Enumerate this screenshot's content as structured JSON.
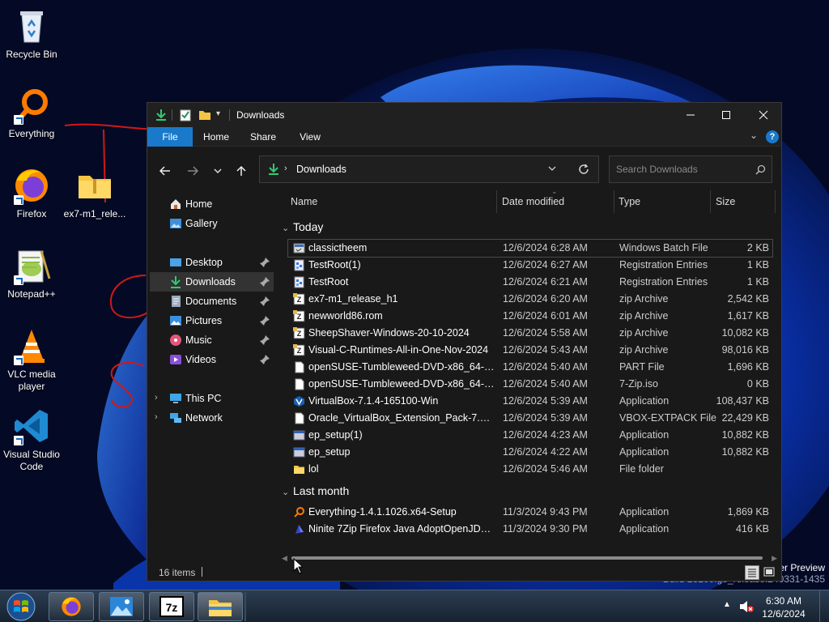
{
  "desktop": {
    "icons": [
      {
        "label": "Recycle Bin",
        "icon": "recycle-bin-icon"
      },
      {
        "label": "Everything",
        "icon": "everything-icon"
      },
      {
        "label": "Firefox",
        "icon": "firefox-icon"
      },
      {
        "label": "ex7-m1_rele...",
        "icon": "folder-zip-icon"
      },
      {
        "label": "Notepad++",
        "icon": "notepadpp-icon"
      },
      {
        "label": "VLC media player",
        "icon": "vlc-icon"
      },
      {
        "label": "Visual Studio Code",
        "icon": "vscode-icon"
      }
    ],
    "watermark_line1": "er Preview",
    "watermark_line2": "Build 26100.ge_release.240331-1435"
  },
  "window": {
    "title": "Downloads",
    "ribbon_tabs": [
      "File",
      "Home",
      "Share",
      "View"
    ],
    "address": {
      "location": "Downloads"
    },
    "search": {
      "placeholder": "Search Downloads"
    },
    "sidebar": {
      "items": [
        {
          "label": "Home",
          "icon": "home-icon",
          "pinned": false
        },
        {
          "label": "Gallery",
          "icon": "gallery-icon",
          "pinned": false
        },
        {
          "label": "Desktop",
          "icon": "desktop-icon",
          "pinned": true
        },
        {
          "label": "Downloads",
          "icon": "downloads-icon",
          "pinned": true,
          "selected": true
        },
        {
          "label": "Documents",
          "icon": "documents-icon",
          "pinned": true
        },
        {
          "label": "Pictures",
          "icon": "pictures-icon",
          "pinned": true
        },
        {
          "label": "Music",
          "icon": "music-icon",
          "pinned": true
        },
        {
          "label": "Videos",
          "icon": "videos-icon",
          "pinned": true
        },
        {
          "label": "This PC",
          "icon": "this-pc-icon",
          "expandable": true
        },
        {
          "label": "Network",
          "icon": "network-icon",
          "expandable": true
        }
      ]
    },
    "columns": [
      "Name",
      "Date modified",
      "Type",
      "Size"
    ],
    "groups": [
      {
        "label": "Today",
        "files": [
          {
            "name": "classictheem",
            "date": "12/6/2024 6:28 AM",
            "type": "Windows Batch File",
            "size": "2 KB",
            "icon": "batch-file-icon"
          },
          {
            "name": "TestRoot(1)",
            "date": "12/6/2024 6:27 AM",
            "type": "Registration Entries",
            "size": "1 KB",
            "icon": "registry-file-icon"
          },
          {
            "name": "TestRoot",
            "date": "12/6/2024 6:21 AM",
            "type": "Registration Entries",
            "size": "1 KB",
            "icon": "registry-file-icon"
          },
          {
            "name": "ex7-m1_release_h1",
            "date": "12/6/2024 6:20 AM",
            "type": "zip Archive",
            "size": "2,542 KB",
            "icon": "7zip-archive-icon"
          },
          {
            "name": "newworld86.rom",
            "date": "12/6/2024 6:01 AM",
            "type": "zip Archive",
            "size": "1,617 KB",
            "icon": "7zip-archive-icon"
          },
          {
            "name": "SheepShaver-Windows-20-10-2024",
            "date": "12/6/2024 5:58 AM",
            "type": "zip Archive",
            "size": "10,082 KB",
            "icon": "7zip-archive-icon"
          },
          {
            "name": "Visual-C-Runtimes-All-in-One-Nov-2024",
            "date": "12/6/2024 5:43 AM",
            "type": "zip Archive",
            "size": "98,016 KB",
            "icon": "7zip-archive-icon"
          },
          {
            "name": "openSUSE-Tumbleweed-DVD-x86_64-Sn...",
            "date": "12/6/2024 5:40 AM",
            "type": "PART File",
            "size": "1,696 KB",
            "icon": "blank-file-icon"
          },
          {
            "name": "openSUSE-Tumbleweed-DVD-x86_64-Sn...",
            "date": "12/6/2024 5:40 AM",
            "type": "7-Zip.iso",
            "size": "0 KB",
            "icon": "blank-file-icon"
          },
          {
            "name": "VirtualBox-7.1.4-165100-Win",
            "date": "12/6/2024 5:39 AM",
            "type": "Application",
            "size": "108,437 KB",
            "icon": "virtualbox-icon"
          },
          {
            "name": "Oracle_VirtualBox_Extension_Pack-7.1.4.v...",
            "date": "12/6/2024 5:39 AM",
            "type": "VBOX-EXTPACK File",
            "size": "22,429 KB",
            "icon": "blank-file-icon"
          },
          {
            "name": "ep_setup(1)",
            "date": "12/6/2024 4:23 AM",
            "type": "Application",
            "size": "10,882 KB",
            "icon": "app-window-icon"
          },
          {
            "name": "ep_setup",
            "date": "12/6/2024 4:22 AM",
            "type": "Application",
            "size": "10,882 KB",
            "icon": "app-window-icon"
          },
          {
            "name": "lol",
            "date": "12/6/2024 5:46 AM",
            "type": "File folder",
            "size": "",
            "icon": "folder-icon"
          }
        ]
      },
      {
        "label": "Last month",
        "files": [
          {
            "name": "Everything-1.4.1.1026.x64-Setup",
            "date": "11/3/2024 9:43 PM",
            "type": "Application",
            "size": "1,869 KB",
            "icon": "everything-icon"
          },
          {
            "name": "Ninite 7Zip Firefox Java AdoptOpenJDK x...",
            "date": "11/3/2024 9:30 PM",
            "type": "Application",
            "size": "416 KB",
            "icon": "ninite-icon"
          }
        ]
      }
    ],
    "status": {
      "count": "16 items"
    }
  },
  "taskbar": {
    "apps": [
      "start-orb-icon",
      "firefox-icon",
      "photos-icon",
      "7zip-icon",
      "file-explorer-icon"
    ],
    "clock_time": "6:30 AM",
    "clock_date": "12/6/2024"
  },
  "colors": {
    "accent": "#1979ca",
    "window_bg": "#191919",
    "titlebar_bg": "#202020",
    "selection": "#333333"
  }
}
